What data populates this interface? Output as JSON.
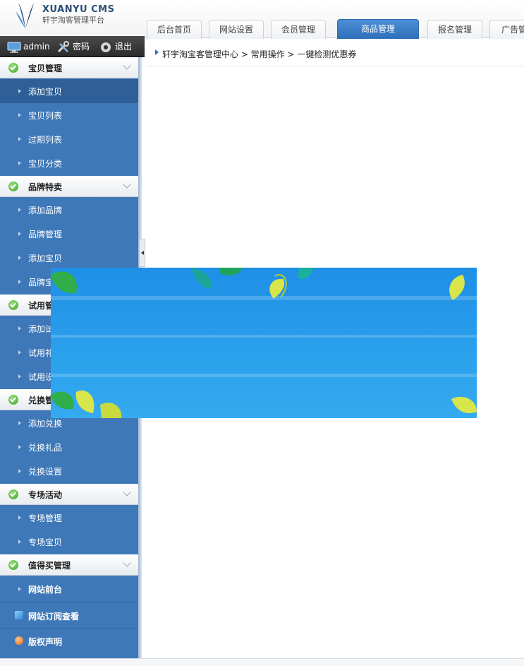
{
  "header": {
    "logo_title": "XUANYU CMS",
    "logo_subtitle": "轩宇淘客管理平台",
    "tabs": [
      {
        "label": "后台首页",
        "active": false
      },
      {
        "label": "网站设置",
        "active": false
      },
      {
        "label": "会员管理",
        "active": false
      },
      {
        "label": "商品管理",
        "active": true
      },
      {
        "label": "报名管理",
        "active": false
      },
      {
        "label": "广告管",
        "active": false
      }
    ]
  },
  "adminbar": {
    "user": "admin",
    "password_label": "密码",
    "logout_label": "退出"
  },
  "sidebar": {
    "groups": [
      {
        "label": "宝贝管理",
        "items": [
          "添加宝贝",
          "宝贝列表",
          "过期列表",
          "宝贝分类"
        ]
      },
      {
        "label": "品牌特卖",
        "items": [
          "添加品牌",
          "品牌管理",
          "添加宝贝",
          "品牌宝"
        ]
      },
      {
        "label": "试用管",
        "items": [
          "添加试",
          "试用礼",
          "试用设"
        ]
      },
      {
        "label": "兑换管",
        "items": [
          "添加兑换",
          "兑换礼品",
          "兑换设置"
        ]
      },
      {
        "label": "专场活动",
        "items": [
          "专场管理",
          "专场宝贝"
        ]
      },
      {
        "label": "值得买管理",
        "items": [
          "网站前台"
        ]
      }
    ],
    "extra_items": [
      {
        "label": "网站订阅查看",
        "icon": "rss-icon"
      },
      {
        "label": "版权声明",
        "icon": "info-icon"
      }
    ]
  },
  "breadcrumb": "轩宇淘宝客管理中心 > 常用操作 > 一键检测优惠券",
  "colors": {
    "sidebar_bg": "#3f78b8",
    "active_tab": "#2d6fb8",
    "banner_sky": "#1e8fe6"
  }
}
